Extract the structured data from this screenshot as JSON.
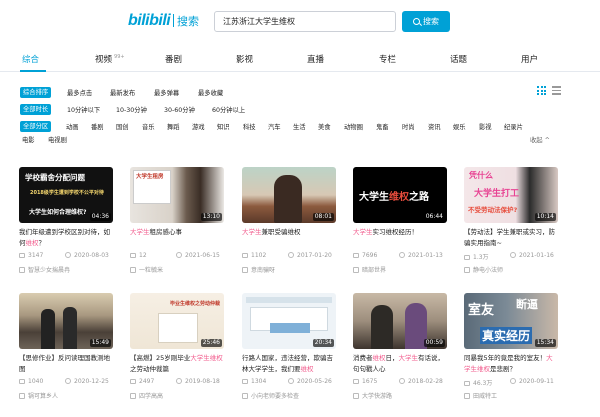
{
  "header": {
    "logo": "bilibili",
    "logo_sub": "搜索",
    "search_value": "江苏浙江大学生维权",
    "search_button": "搜索"
  },
  "tabs": [
    {
      "label": "综合",
      "count": ""
    },
    {
      "label": "视频",
      "count": "99+"
    },
    {
      "label": "番剧",
      "count": ""
    },
    {
      "label": "影视",
      "count": ""
    },
    {
      "label": "直播",
      "count": ""
    },
    {
      "label": "专栏",
      "count": ""
    },
    {
      "label": "话题",
      "count": ""
    },
    {
      "label": "用户",
      "count": ""
    }
  ],
  "filters": {
    "sort": [
      "综合排序",
      "最多点击",
      "最新发布",
      "最多弹幕",
      "最多收藏"
    ],
    "duration": [
      "全部时长",
      "10分钟以下",
      "10-30分钟",
      "30-60分钟",
      "60分钟以上"
    ],
    "zones": [
      "全部分区",
      "动画",
      "番剧",
      "国创",
      "音乐",
      "舞蹈",
      "游戏",
      "知识",
      "科技",
      "汽车",
      "生活",
      "美食",
      "动物圈",
      "鬼畜",
      "时尚",
      "资讯",
      "娱乐",
      "影视",
      "纪录片"
    ],
    "zones2": [
      "电影",
      "电视剧"
    ],
    "collapse": "收起 ^"
  },
  "videos": [
    {
      "title_pre": "我们年级遭到学校区别对待，如何",
      "title_hl": "维权",
      "title_post": "？",
      "duration": "04:36",
      "plays": "3147",
      "date": "2020-08-03",
      "uploader": "智慧少女揣晨冉",
      "overlay": [
        "学校霸舍分配问题",
        "2018级学生遭到学校不公平对待",
        "大学生如何合理维权?"
      ]
    },
    {
      "title_pre": "",
      "title_hl": "大学生",
      "title_post": "租房感心事",
      "duration": "13:10",
      "plays": "12",
      "date": "2021-06-15",
      "uploader": "一粒毓米",
      "overlay": [
        "大学生租房"
      ]
    },
    {
      "title_pre": "",
      "title_hl": "大学生",
      "title_post": "兼职受骗维权",
      "duration": "08:01",
      "plays": "1102",
      "date": "2017-01-20",
      "uploader": "意南骗呀",
      "overlay": []
    },
    {
      "title_pre": "",
      "title_hl": "大学生",
      "title_post": "实习维权经历！",
      "duration": "06:44",
      "plays": "7696",
      "date": "2021-01-13",
      "uploader": "暗部世界",
      "overlay": [
        "大学生",
        "维权",
        "之路"
      ]
    },
    {
      "title_pre": "【劳动法】学生兼职或实习，防骗实用指南~",
      "title_hl": "",
      "title_post": "",
      "duration": "10:14",
      "plays": "1.3万",
      "date": "2021-01-16",
      "uploader": "静电小法师",
      "overlay": [
        "凭什么",
        "大学生打工",
        "不受劳动法保护?"
      ]
    },
    {
      "title_pre": "【思修作业】反问读理国教测地图",
      "title_hl": "",
      "title_post": "",
      "duration": "15:49",
      "plays": "1040",
      "date": "2020-12-25",
      "uploader": "锅可算乡人",
      "overlay": []
    },
    {
      "title_pre": "【高燃】25岁刚毕业",
      "title_hl": "大学生维权",
      "title_post": "之劳动仲裁篇",
      "duration": "25:46",
      "plays": "2497",
      "date": "2019-08-18",
      "uploader": "四学高高",
      "overlay": [
        "毕业生维权之劳动仲裁"
      ]
    },
    {
      "title_pre": "行路人国家，违法经营，欺骗吉林大学学生，我们要",
      "title_hl": "维权",
      "title_post": "",
      "duration": "20:34",
      "plays": "1304",
      "date": "2020-05-26",
      "uploader": "小向老师要多检查",
      "overlay": []
    },
    {
      "title_pre": "消费者",
      "title_hl": "维权",
      "title_post": "日，",
      "title_hl2": "大学生",
      "title_post2": "有话说，句句戳人心",
      "duration": "00:59",
      "plays": "1675",
      "date": "2018-02-28",
      "uploader": "大学快游路",
      "overlay": []
    },
    {
      "title_pre": "同暴我5年的竟是我的室友！",
      "title_hl": "大学生维权",
      "title_post": "是悲剧？",
      "duration": "15:34",
      "plays": "46.3万",
      "date": "2020-09-11",
      "uploader": "田威特工",
      "overlay": [
        "室友",
        "断逼",
        "真实经历"
      ]
    }
  ]
}
